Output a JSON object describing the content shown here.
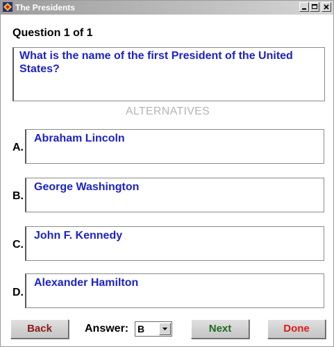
{
  "window": {
    "title": "The Presidents"
  },
  "question": {
    "counter": "Question 1 of 1",
    "text": "What is the name of the first President of the United States?"
  },
  "alternatives": {
    "heading": "ALTERNATIVES",
    "items": [
      {
        "letter": "A.",
        "text": "Abraham Lincoln"
      },
      {
        "letter": "B.",
        "text": "George Washington"
      },
      {
        "letter": "C.",
        "text": "John F. Kennedy"
      },
      {
        "letter": "D.",
        "text": "Alexander Hamilton"
      }
    ]
  },
  "footer": {
    "back_label": "Back",
    "answer_label": "Answer:",
    "answer_value": "B",
    "next_label": "Next",
    "done_label": "Done"
  },
  "colors": {
    "question_text": "#1e22c8",
    "back": "#8b1a1a",
    "next": "#1e6b1e",
    "done": "#e01a1a"
  }
}
